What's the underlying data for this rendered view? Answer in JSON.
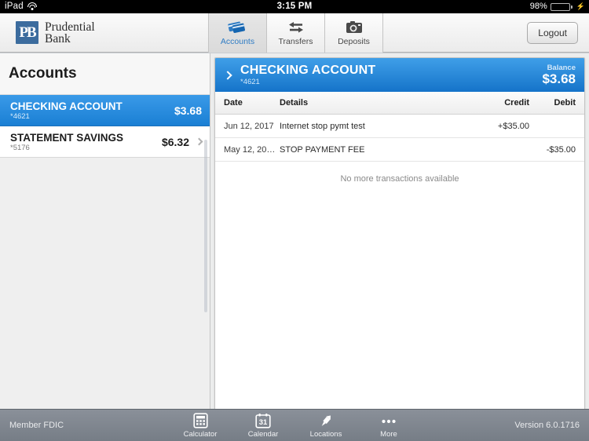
{
  "statusbar": {
    "device": "iPad",
    "wifi_icon": "wifi-icon",
    "time": "3:15 PM",
    "battery_percent": "98%",
    "battery_icon": "battery-icon",
    "charging_icon": "lightning-bolt-icon"
  },
  "topbar": {
    "brand_mark": "PB",
    "brand_line1": "Prudential",
    "brand_line2": "Bank",
    "tabs": [
      {
        "label": "Accounts",
        "icon": "credit-cards-icon",
        "active": true
      },
      {
        "label": "Transfers",
        "icon": "transfer-arrows-icon",
        "active": false
      },
      {
        "label": "Deposits",
        "icon": "camera-icon",
        "active": false
      }
    ],
    "logout_label": "Logout"
  },
  "sidebar": {
    "title": "Accounts",
    "accounts": [
      {
        "name": "CHECKING ACCOUNT",
        "number": "*4621",
        "balance": "$3.68",
        "selected": true
      },
      {
        "name": "STATEMENT SAVINGS",
        "number": "*5176",
        "balance": "$6.32",
        "selected": false
      }
    ]
  },
  "account_detail": {
    "chevron_icon": "chevron-right-icon",
    "name": "CHECKING ACCOUNT",
    "number": "*4621",
    "balance_label": "Balance",
    "balance": "$3.68",
    "columns": {
      "date": "Date",
      "details": "Details",
      "credit": "Credit",
      "debit": "Debit"
    },
    "transactions": [
      {
        "date": "Jun 12, 2017",
        "details": "Internet stop pymt test",
        "credit": "+$35.00",
        "debit": ""
      },
      {
        "date": "May 12, 20…",
        "details": "STOP PAYMENT FEE",
        "credit": "",
        "debit": "-$35.00"
      }
    ],
    "empty_message": "No more transactions available"
  },
  "toolbar": {
    "fdic_text": "Member FDIC",
    "items": [
      {
        "label": "Calculator",
        "icon": "calculator-icon"
      },
      {
        "label": "Calendar",
        "icon": "calendar-icon",
        "day": "31"
      },
      {
        "label": "Locations",
        "icon": "map-pin-icon"
      },
      {
        "label": "More",
        "icon": "ellipsis-icon"
      }
    ],
    "version": "Version 6.0.1716"
  },
  "colors": {
    "accent_blue": "#1a7fd4",
    "header_blue_top": "#3f9fe8",
    "header_blue_bottom": "#1573c9",
    "brand_blue": "#3c6c9e",
    "battery_green": "#4cd964",
    "toolbar_gray": "#7d848d"
  }
}
